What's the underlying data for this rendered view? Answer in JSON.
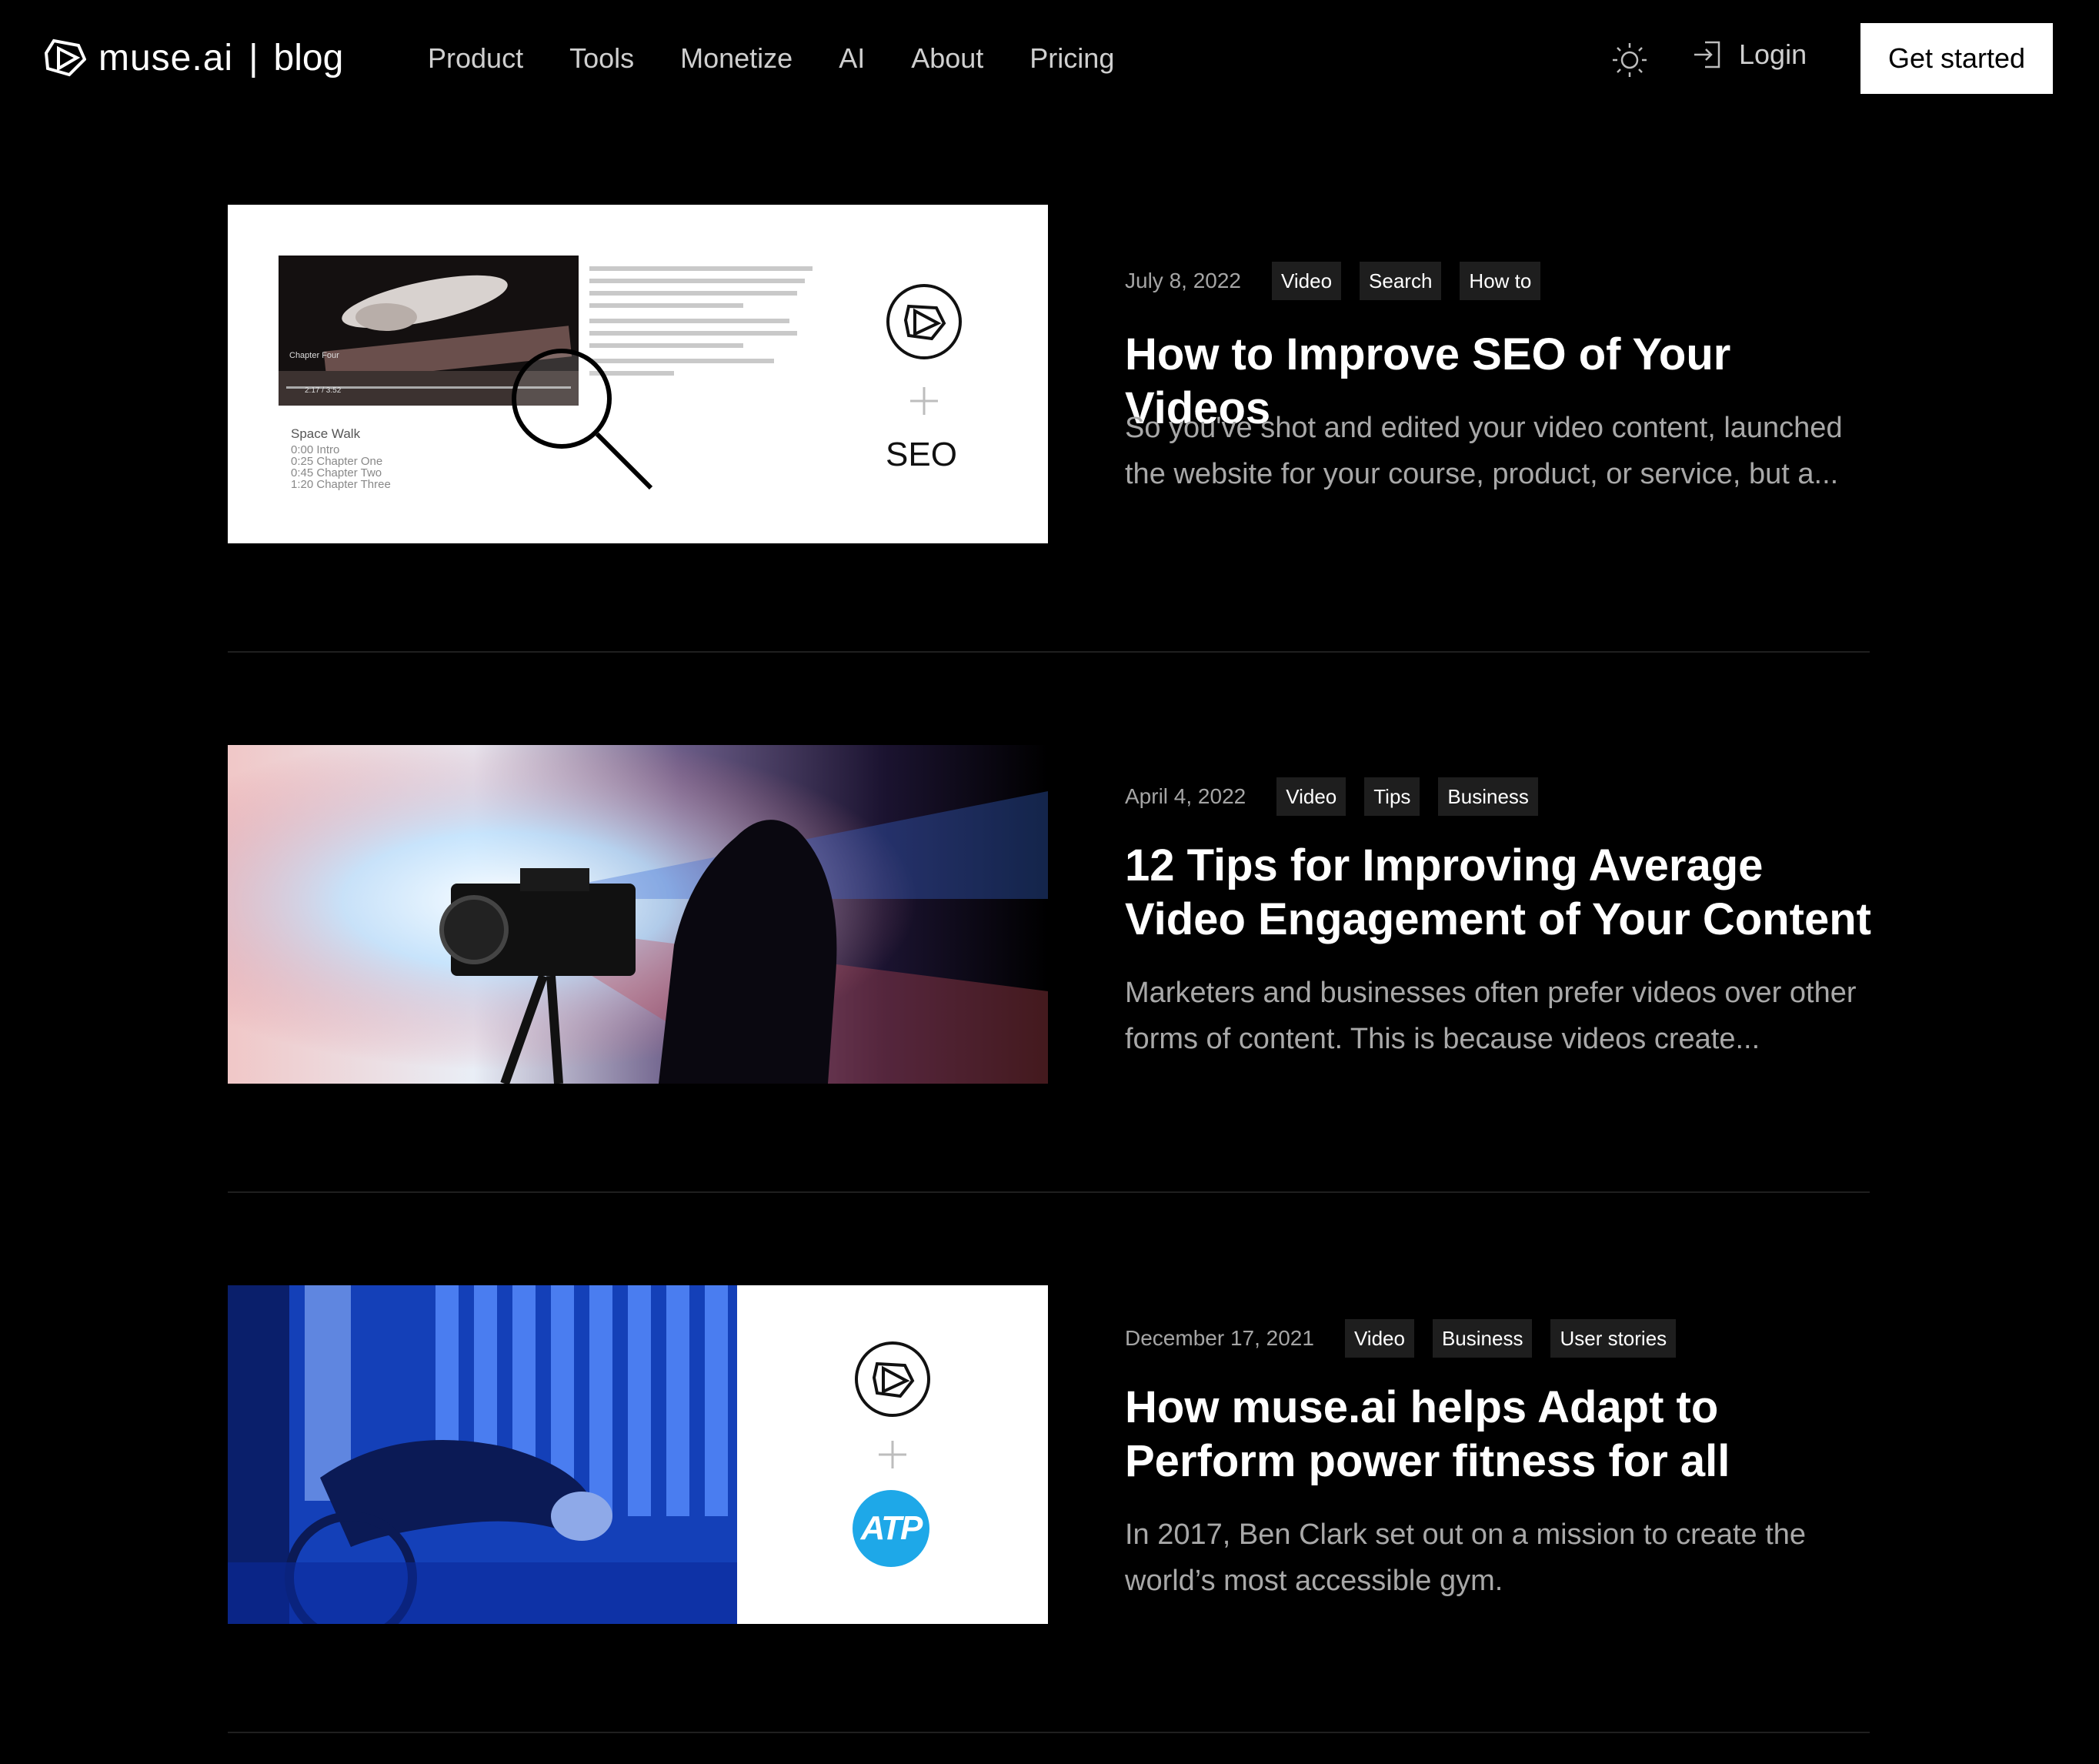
{
  "brand": {
    "name": "muse.ai",
    "separator": "|",
    "section": "blog"
  },
  "nav": [
    "Product",
    "Tools",
    "Monetize",
    "AI",
    "About",
    "Pricing"
  ],
  "header": {
    "login_label": "Login",
    "cta_label": "Get started"
  },
  "icons": {
    "theme": "sun-icon",
    "login": "login-icon",
    "logo": "muse-logo-icon"
  },
  "posts": [
    {
      "date": "July 8, 2022",
      "tags": [
        "Video",
        "Search",
        "How to"
      ],
      "title": "How to Improve SEO of Your Videos",
      "excerpt": "So you've shot and edited your video content, launched the website for your course, product, or service, but a...",
      "thumb": {
        "word": "SEO",
        "chapters_heading": "Space Walk",
        "chapters": [
          "0:00 Intro",
          "0:25 Chapter One",
          "0:45 Chapter Two",
          "1:20 Chapter Three"
        ],
        "video_label": "Chapter Four",
        "time": "2:17 / 3:52"
      }
    },
    {
      "date": "April 4, 2022",
      "tags": [
        "Video",
        "Tips",
        "Business"
      ],
      "title": "12 Tips for Improving Average Video Engagement of Your Content",
      "excerpt": "Marketers and businesses often prefer videos over other forms of content. This is because videos create..."
    },
    {
      "date": "December 17, 2021",
      "tags": [
        "Video",
        "Business",
        "User stories"
      ],
      "title": "How muse.ai helps Adapt to Perform power fitness for all",
      "excerpt": "In 2017, Ben Clark set out on a mission to create the world’s most accessible gym.",
      "thumb": {
        "partner_logo": "ATP"
      }
    }
  ],
  "colors": {
    "background": "#000000",
    "text": "#ffffff",
    "muted": "#a8a8a8",
    "tag_bg": "#1e1e1e",
    "atp_blue": "#1ea8e8"
  }
}
